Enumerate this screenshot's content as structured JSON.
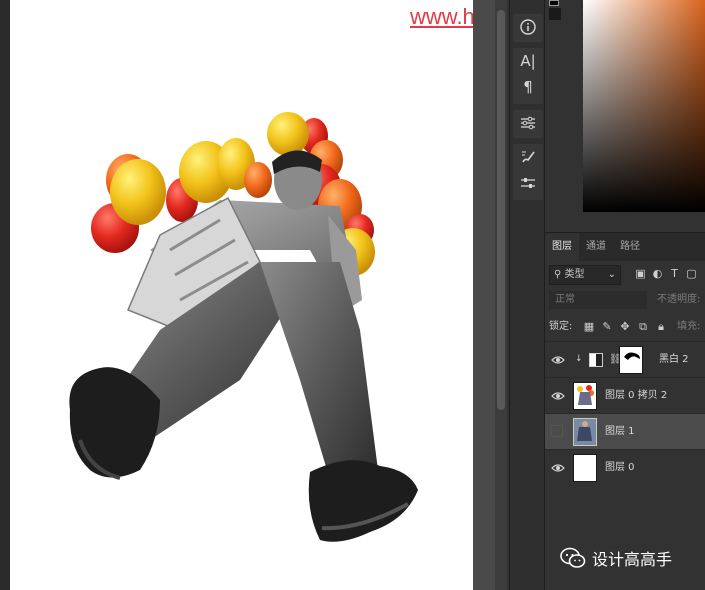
{
  "watermark": "www.hanyudansheji.com",
  "toolbar": {
    "tools": [
      {
        "name": "info-icon"
      },
      {
        "name": "character-icon",
        "label": "A|"
      },
      {
        "name": "paragraph-icon",
        "label": "¶"
      },
      {
        "name": "properties-icon"
      },
      {
        "name": "brush-settings-icon"
      },
      {
        "name": "adjustments-icon"
      }
    ]
  },
  "colors": {
    "canvas_bg": "#ffffff",
    "panel_bg": "#323232",
    "selected_row": "#4b4b4b",
    "watermark": "#e5394a",
    "picker_hue": "#d9651f"
  },
  "layers_panel": {
    "tabs": [
      "图层",
      "通道",
      "路径"
    ],
    "active_tab": "图层",
    "filter": {
      "label": "类型"
    },
    "blend_mode": "正常",
    "opacity_label": "不透明度:",
    "lock_label": "锁定:",
    "fill_label": "填充:",
    "layers": [
      {
        "name": "黑白 2",
        "visible": true,
        "type": "adjustment",
        "clipped": true
      },
      {
        "name": "图层 0 拷贝 2",
        "visible": true,
        "type": "image"
      },
      {
        "name": "图层 1",
        "visible": false,
        "type": "image",
        "selected": true
      },
      {
        "name": "图层 0",
        "visible": true,
        "type": "fill"
      }
    ]
  },
  "brand": {
    "name": "设计高高手"
  }
}
